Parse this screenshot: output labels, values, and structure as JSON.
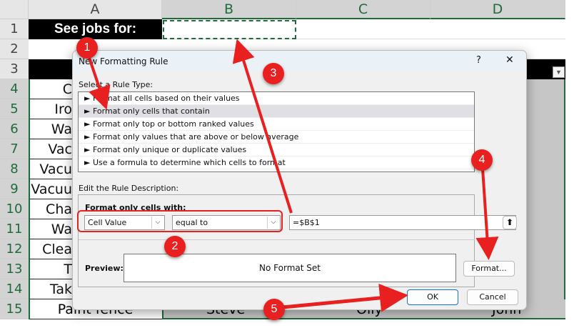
{
  "sheet": {
    "columns": [
      "A",
      "B",
      "C",
      "D"
    ],
    "rows": [
      "1",
      "2",
      "3",
      "4",
      "5",
      "6",
      "7",
      "8",
      "9",
      "10",
      "11",
      "12",
      "13",
      "14",
      "15"
    ],
    "a1": "See jobs for:",
    "col_a_visible": [
      "C",
      "Iro",
      "Wa",
      "Vac",
      "Vacu",
      "Vacuu",
      "Cha",
      "Wa",
      "Clea",
      "T",
      "Tak"
    ],
    "row15": {
      "a": "Paint fence",
      "b": "Steve",
      "c": "Olly",
      "d": "John"
    }
  },
  "dialog": {
    "title": "New Formatting Rule",
    "help": "?",
    "close": "✕",
    "select_label": "Select a Rule Type:",
    "rule_types": [
      "Format all cells based on their values",
      "Format only cells that contain",
      "Format only top or bottom ranked values",
      "Format only values that are above or below average",
      "Format only unique or duplicate values",
      "Use a formula to determine which cells to format"
    ],
    "selected_index": 1,
    "edit_label": "Edit the Rule Description:",
    "format_with_label": "Format only cells with:",
    "condition1": "Cell Value",
    "condition2": "equal to",
    "value": "=$B$1",
    "preview_label": "Preview:",
    "preview_text": "No Format Set",
    "format_button": "Format...",
    "ok": "OK",
    "cancel": "Cancel"
  },
  "annotations": [
    "1",
    "2",
    "3",
    "4",
    "5"
  ],
  "colors": {
    "annotation": "#e8201f",
    "excel_green": "#1e6b3b",
    "selected_row": "#e0e0e4"
  }
}
